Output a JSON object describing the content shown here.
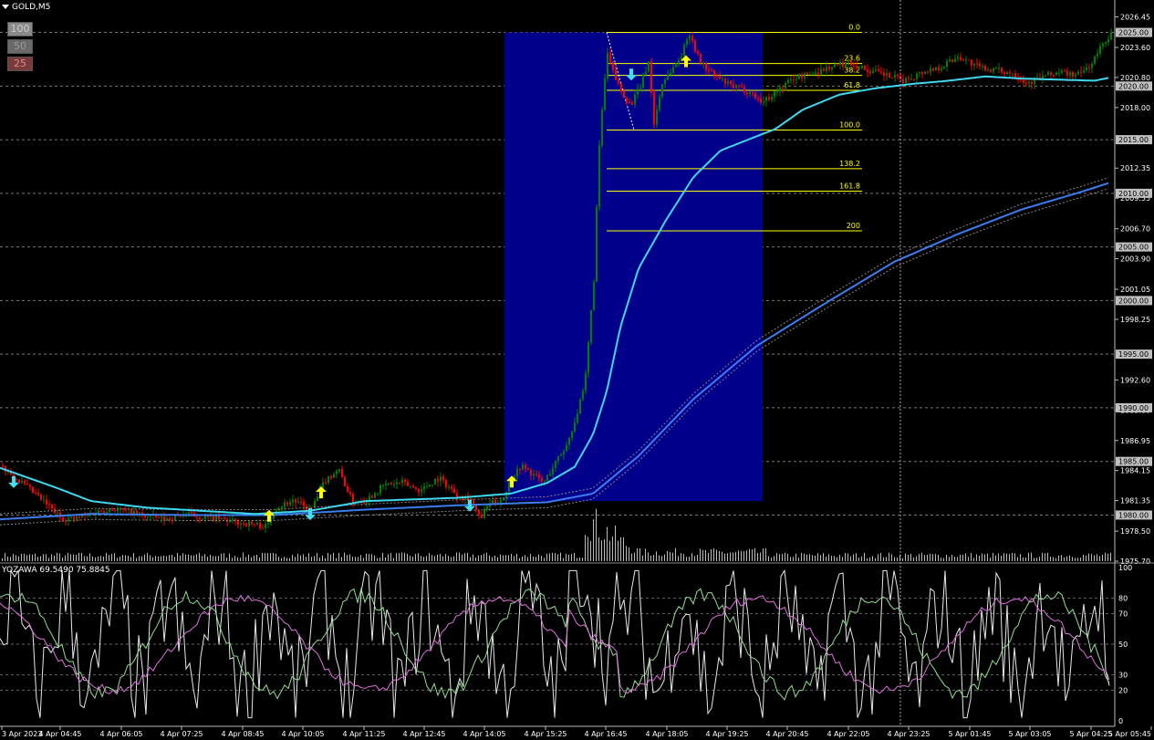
{
  "symbol_label": "GOLD,M5",
  "buttons": [
    "100",
    "50",
    "25"
  ],
  "indicator_label": "YOZAWA 69.5490 75.8845",
  "colors": {
    "background": "#000000",
    "bull_bar": "#008000",
    "bear_bar": "#ff0000",
    "fast_ma": "#40d8f0",
    "slow_ma": "#3a7ef0",
    "fib_line": "#ffff00",
    "fib_zone": "#00008b",
    "osc_main": "#e8e8e8",
    "osc_signal": "#e070e0",
    "osc_third": "#90e090"
  },
  "chart_data": {
    "type": "line",
    "symbol": "GOLD",
    "timeframe": "M5",
    "ylim": [
      1975.7,
      2027.6
    ],
    "y_ticks": [
      "2026.45",
      "2023.60",
      "2020.80",
      "2018.00",
      "2012.35",
      "2009.55",
      "2006.70",
      "2003.90",
      "2001.05",
      "1998.25",
      "1992.60",
      "1989.80",
      "1986.95",
      "1984.15",
      "1981.35",
      "1978.50",
      "1975.70"
    ],
    "horizontal_levels": [
      "2025.00",
      "2020.00",
      "2015.00",
      "2010.00",
      "2005.00",
      "2000.00",
      "1995.00",
      "1990.00",
      "1985.00",
      "1980.00"
    ],
    "x_labels": [
      "3 Apr 2023",
      "4 Apr 04:45",
      "4 Apr 06:05",
      "4 Apr 07:25",
      "4 Apr 08:45",
      "4 Apr 10:05",
      "4 Apr 11:25",
      "4 Apr 12:45",
      "4 Apr 14:05",
      "4 Apr 15:25",
      "4 Apr 16:45",
      "4 Apr 18:05",
      "4 Apr 19:25",
      "4 Apr 20:45",
      "4 Apr 22:05",
      "4 Apr 23:25",
      "5 Apr 01:45",
      "5 Apr 03:05",
      "5 Apr 04:25",
      "5 Apr 05:45"
    ],
    "price_key": [
      [
        0,
        1984.6
      ],
      [
        10,
        1983.9
      ],
      [
        30,
        1982.5
      ],
      [
        50,
        1981.0
      ],
      [
        65,
        1979.8
      ],
      [
        80,
        1979.6
      ],
      [
        100,
        1980.2
      ],
      [
        120,
        1980.6
      ],
      [
        140,
        1980.3
      ],
      [
        160,
        1979.9
      ],
      [
        180,
        1979.6
      ],
      [
        200,
        1980.1
      ],
      [
        220,
        1979.8
      ],
      [
        240,
        1979.6
      ],
      [
        260,
        1979.3
      ],
      [
        280,
        1979.1
      ],
      [
        292,
        1978.9
      ],
      [
        300,
        1980.6
      ],
      [
        320,
        1981.4
      ],
      [
        340,
        1980.4
      ],
      [
        355,
        1983.2
      ],
      [
        370,
        1984.3
      ],
      [
        385,
        1981.3
      ],
      [
        400,
        1981.4
      ],
      [
        420,
        1982.8
      ],
      [
        440,
        1983.0
      ],
      [
        460,
        1982.3
      ],
      [
        480,
        1983.5
      ],
      [
        500,
        1981.9
      ],
      [
        515,
        1981.5
      ],
      [
        525,
        1979.6
      ],
      [
        535,
        1981.0
      ],
      [
        550,
        1981.5
      ],
      [
        560,
        1983.5
      ],
      [
        570,
        1984.6
      ],
      [
        580,
        1984.0
      ],
      [
        595,
        1983.0
      ],
      [
        610,
        1985.2
      ],
      [
        620,
        1986.5
      ],
      [
        630,
        1989.0
      ],
      [
        640,
        1992.0
      ],
      [
        650,
        2002.0
      ],
      [
        655,
        2013.0
      ],
      [
        660,
        2019.0
      ],
      [
        665,
        2023.0
      ],
      [
        672,
        2021.0
      ],
      [
        680,
        2019.6
      ],
      [
        690,
        2018.2
      ],
      [
        700,
        2019.8
      ],
      [
        710,
        2022.3
      ],
      [
        716,
        2016.5
      ],
      [
        725,
        2020.3
      ],
      [
        735,
        2021.5
      ],
      [
        745,
        2022.7
      ],
      [
        755,
        2025.0
      ],
      [
        765,
        2022.5
      ],
      [
        775,
        2021.5
      ],
      [
        785,
        2020.8
      ],
      [
        800,
        2020.0
      ],
      [
        820,
        2019.5
      ],
      [
        835,
        2018.5
      ],
      [
        850,
        2019.5
      ],
      [
        870,
        2020.8
      ],
      [
        890,
        2021.2
      ],
      [
        910,
        2021.8
      ],
      [
        930,
        2022.2
      ],
      [
        950,
        2021.5
      ],
      [
        970,
        2021.0
      ],
      [
        990,
        2020.5
      ],
      [
        1010,
        2021.3
      ],
      [
        1030,
        2021.8
      ],
      [
        1050,
        2022.8
      ],
      [
        1070,
        2021.8
      ],
      [
        1090,
        2021.5
      ],
      [
        1110,
        2021.2
      ],
      [
        1125,
        2020.3
      ],
      [
        1140,
        2020.8
      ],
      [
        1160,
        2021.3
      ],
      [
        1180,
        2021.0
      ],
      [
        1195,
        2022.0
      ],
      [
        1205,
        2023.5
      ],
      [
        1212,
        2024.4
      ],
      [
        1217,
        2024.8
      ]
    ],
    "fast_ma_key": [
      [
        0,
        1984.4
      ],
      [
        60,
        1982.6
      ],
      [
        100,
        1981.3
      ],
      [
        160,
        1980.7
      ],
      [
        220,
        1980.4
      ],
      [
        280,
        1980.1
      ],
      [
        340,
        1980.4
      ],
      [
        400,
        1981.3
      ],
      [
        500,
        1981.6
      ],
      [
        560,
        1982.0
      ],
      [
        600,
        1983.0
      ],
      [
        630,
        1984.5
      ],
      [
        650,
        1987.5
      ],
      [
        665,
        1991.5
      ],
      [
        680,
        1997.5
      ],
      [
        700,
        2003.0
      ],
      [
        730,
        2007.5
      ],
      [
        760,
        2011.5
      ],
      [
        790,
        2014.0
      ],
      [
        820,
        2015.0
      ],
      [
        850,
        2016.0
      ],
      [
        880,
        2017.8
      ],
      [
        920,
        2019.2
      ],
      [
        960,
        2019.8
      ],
      [
        1000,
        2020.2
      ],
      [
        1040,
        2020.5
      ],
      [
        1080,
        2020.9
      ],
      [
        1120,
        2020.7
      ],
      [
        1160,
        2020.6
      ],
      [
        1200,
        2020.5
      ],
      [
        1217,
        2020.8
      ]
    ],
    "slow_ma_key": [
      [
        0,
        1979.6
      ],
      [
        100,
        1980.1
      ],
      [
        200,
        1980.0
      ],
      [
        300,
        1980.0
      ],
      [
        400,
        1980.5
      ],
      [
        500,
        1980.9
      ],
      [
        600,
        1981.2
      ],
      [
        650,
        1982.0
      ],
      [
        700,
        1985.5
      ],
      [
        760,
        1990.8
      ],
      [
        830,
        1995.8
      ],
      [
        900,
        1999.5
      ],
      [
        980,
        2003.6
      ],
      [
        1050,
        2006.2
      ],
      [
        1120,
        2008.5
      ],
      [
        1180,
        2010.0
      ],
      [
        1217,
        2011.0
      ]
    ],
    "fib_levels": [
      "0.0",
      "23.6",
      "38.2",
      "61.8",
      "100.0",
      "138.2",
      "161.8",
      "200"
    ],
    "fib_prices": [
      2025.0,
      2022.1,
      2021.0,
      2019.6,
      2015.9,
      2012.3,
      2010.2,
      2006.5
    ],
    "oscillator_ylim": [
      0,
      100
    ],
    "oscillator_ticks": [
      "100",
      "80",
      "70",
      "50",
      "30",
      "20",
      "0"
    ],
    "oscillator_values": [
      69.549,
      75.8845
    ]
  }
}
